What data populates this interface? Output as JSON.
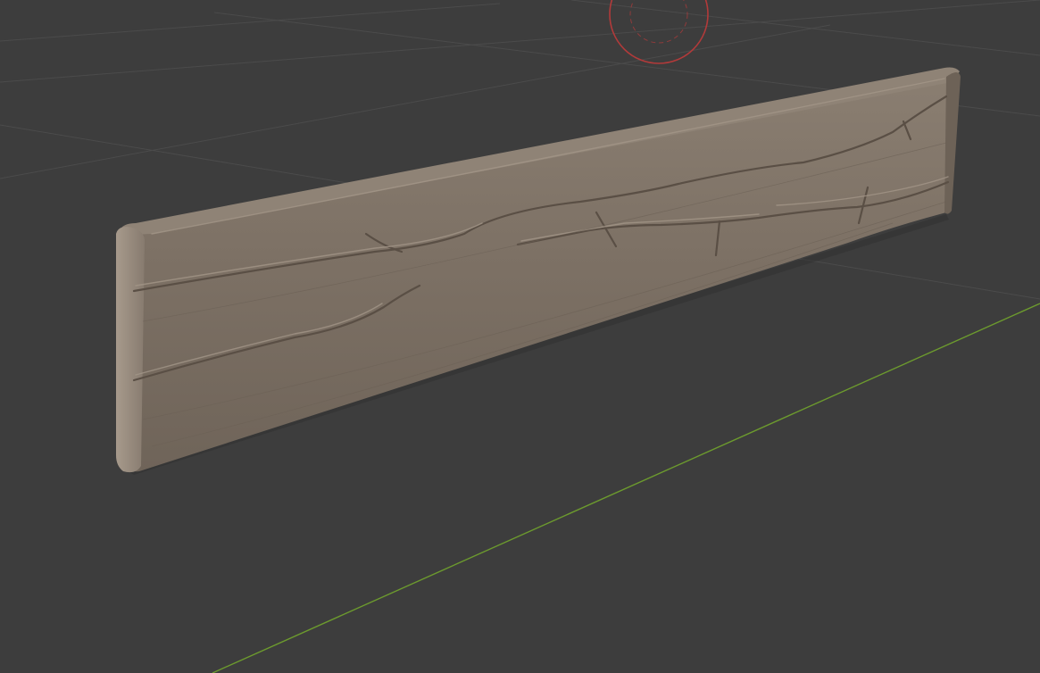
{
  "viewport": {
    "background_color": "#3d3d3d",
    "grid_line_color": "#4d4d4d",
    "x_axis_color": "#6c9a2e",
    "cursor_color": "#b23a3a",
    "object": {
      "kind": "sculpted-wooden-plank",
      "front_color": "#7e7266",
      "top_color": "#8b7f72",
      "end_color": "#9a8d80",
      "shadow_color": "#5c5249",
      "crack_color": "#5a4f45",
      "highlight_color": "#a39688"
    },
    "icons": {
      "cursor": "3d-cursor-icon"
    }
  }
}
